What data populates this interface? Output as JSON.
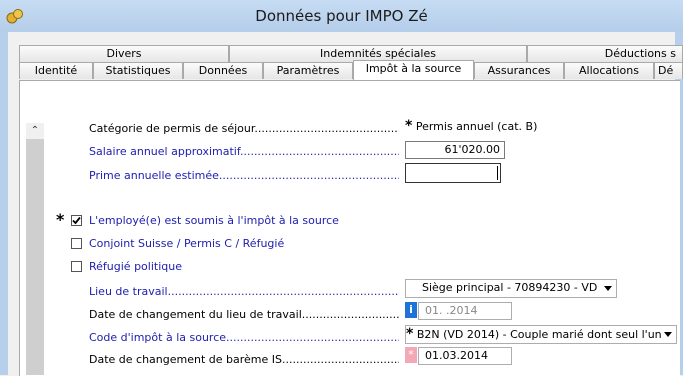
{
  "window": {
    "title": "Données pour IMPO Zé"
  },
  "tabs_row1": [
    {
      "label": "Divers"
    },
    {
      "label": "Indemnités spéciales"
    },
    {
      "label": "Déductions s"
    }
  ],
  "tabs_row2": [
    {
      "label": "Identité"
    },
    {
      "label": "Statistiques"
    },
    {
      "label": "Données"
    },
    {
      "label": "Paramètres"
    },
    {
      "label": "Impôt à la source",
      "active": true
    },
    {
      "label": "Assurances"
    },
    {
      "label": "Allocations"
    },
    {
      "label": "Dé"
    }
  ],
  "form": {
    "permis_label": "Catégorie de permis de séjour",
    "permis_value": "Permis annuel (cat. B)",
    "salaire_label": "Salaire annuel approximatif",
    "salaire_value": "61'020.00",
    "prime_label": "Prime annuelle estimée",
    "prime_value": "",
    "soumis_label": "L'employé(e) est soumis à l'impôt à la source",
    "soumis_checked": true,
    "conjoint_label": "Conjoint Suisse / Permis C / Réfugié",
    "conjoint_checked": false,
    "refugie_label": "Réfugié politique",
    "refugie_checked": false,
    "lieu_label": "Lieu de travail",
    "lieu_value": "Siège principal - 70894230 - VD",
    "date_lieu_label": "Date de changement du lieu de travail",
    "date_lieu_value": "01.  .2014",
    "code_label": "Code d'impôt à la source",
    "code_value": "B2N (VD 2014) - Couple marié dont seul l'un",
    "date_bareme_label": "Date de changement de barème IS",
    "date_bareme_value": "01.03.2014"
  },
  "markers": {
    "asterisk": "*",
    "dots": "............................................................................................................"
  },
  "colors": {
    "blue_label": "#2020b0",
    "info_icon": "#1e73d8",
    "pink_icon": "#f3a7b7"
  }
}
